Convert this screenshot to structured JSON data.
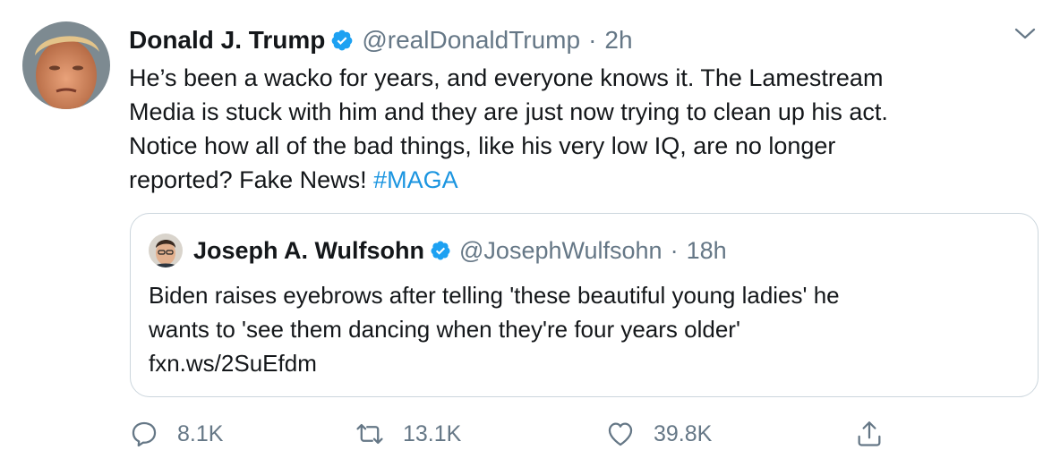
{
  "author": {
    "name": "Donald J. Trump",
    "handle": "@realDonaldTrump",
    "separator": "·",
    "time": "2h",
    "verified": true
  },
  "tweet": {
    "lines": [
      "He’s been a wacko for years, and everyone knows it. The Lamestream",
      "Media is stuck with him and they are just now trying to clean up his act.",
      "Notice how all of the bad things, like his very low IQ, are no longer"
    ],
    "last_line_text": "reported? Fake News! ",
    "hashtag": "#MAGA"
  },
  "quoted": {
    "name": "Joseph A. Wulfsohn",
    "handle": "@JosephWulfsohn",
    "separator": "·",
    "time": "18h",
    "verified": true,
    "lines": [
      "Biden raises eyebrows after telling 'these beautiful young ladies' he",
      "wants to 'see them dancing when they're four years older'",
      "fxn.ws/2SuEfdm"
    ]
  },
  "actions": {
    "reply_count": "8.1K",
    "retweet_count": "13.1K",
    "like_count": "39.8K"
  },
  "icons": {
    "verified": "verified-badge-icon",
    "more": "chevron-down-icon",
    "reply": "reply-icon",
    "retweet": "retweet-icon",
    "like": "heart-icon",
    "share": "share-icon"
  },
  "colors": {
    "text": "#14171a",
    "secondary": "#657786",
    "link": "#1b95e0",
    "verified": "#1da1f2",
    "border": "#ccd6dd"
  }
}
